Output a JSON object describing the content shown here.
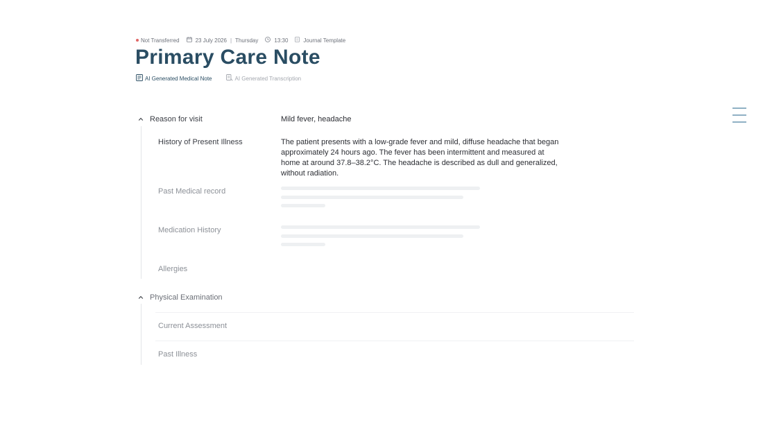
{
  "meta": {
    "status": "Not Transferred",
    "date": "23 July 2026",
    "separator": "|",
    "weekday": "Thursday",
    "time": "13:30",
    "template": "Journal Template"
  },
  "page": {
    "title": "Primary Care Note"
  },
  "tabs": {
    "active_label": "AI Generated Medical Note",
    "inactive_label": "AI Generated Transcription"
  },
  "sections": {
    "reason": {
      "label": "Reason for visit",
      "value": "Mild fever, headache"
    },
    "history": {
      "hpi_label": "History of Present Illness",
      "hpi_value": "The patient presents with a low-grade fever and mild, diffuse headache that began approximately 24 hours ago. The fever has been intermittent and measured at home at around 37.8–38.2°C. The headache is described as dull and generalized, without radiation.",
      "pmr_label": "Past Medical record",
      "med_label": "Medication History",
      "allergies_label": "Allergies"
    },
    "physical": {
      "label": "Physical Examination",
      "current_label": "Current Assessment",
      "past_label": "Past Illness"
    }
  },
  "colors": {
    "title": "#2a4d63",
    "status_dot": "#e06666",
    "menu_lines": "#8fb0c4",
    "skeleton": "#eef0f2"
  },
  "icons": {
    "date": "calendar-icon",
    "time": "clock-icon",
    "template": "document-icon",
    "medical_note": "medical-note-icon",
    "transcription": "transcription-icon",
    "collapse": "chevron-up-icon",
    "menu": "menu-lines-icon"
  }
}
